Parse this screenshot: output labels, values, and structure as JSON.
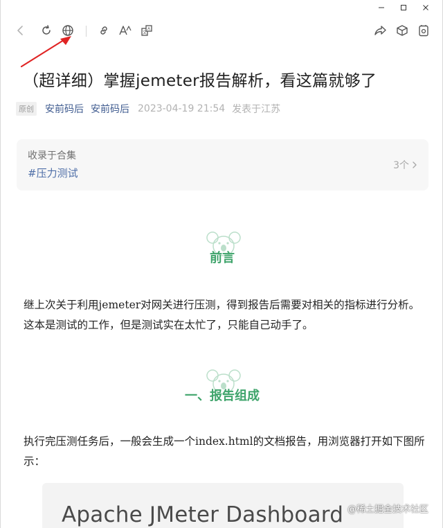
{
  "window_controls": {
    "minimize": "minimize",
    "maximize": "maximize",
    "close": "close"
  },
  "toolbar": {
    "left_icons": [
      "back-icon",
      "refresh-icon",
      "globe-icon",
      "link-icon",
      "font-size-icon",
      "translate-icon"
    ],
    "right_icons": [
      "share-icon",
      "cube-icon",
      "mini-program-icon"
    ]
  },
  "article": {
    "title": "（超详细）掌握jemeter报告解析，看这篇就够了",
    "original_badge": "原创",
    "author_1": "安前码后",
    "author_2": "安前码后",
    "date": "2023-04-19 21:54",
    "location": "发表于江苏"
  },
  "collection": {
    "label": "收录于合集",
    "tag": "#压力测试",
    "count": "3个"
  },
  "sections": {
    "preface_heading": "前言",
    "preface_text": "继上次关于利用jemeter对网关进行压测，得到报告后需要对相关的指标进行分析。这本是测试的工作，但是测试实在太忙了，只能自己动手了。",
    "section1_heading": "一、报告组成",
    "section1_text": "执行完压测任务后，一般会生成一个index.html的文档报告，用浏览器打开如下图所示："
  },
  "image": {
    "dashboard_title": "Apache JMeter Dashboard"
  },
  "watermark": "@稀土掘金技术社区",
  "colors": {
    "accent_green": "#3fa46b",
    "link_blue": "#3f5b8f",
    "arrow_red": "#e02424"
  }
}
